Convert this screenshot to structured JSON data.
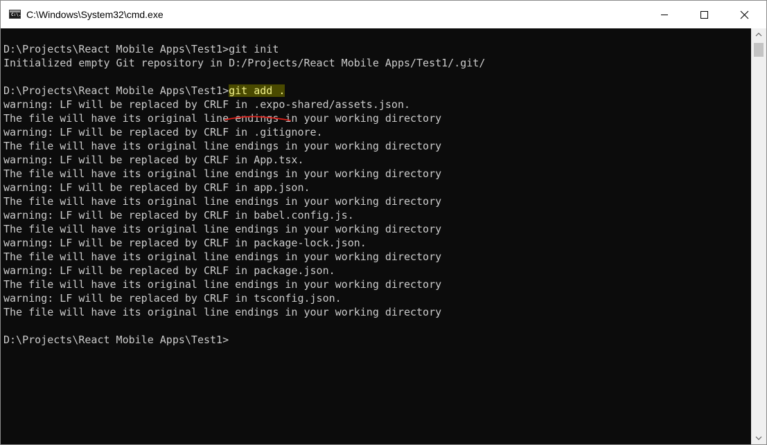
{
  "window": {
    "title": "C:\\Windows\\System32\\cmd.exe",
    "icon": "cmd-app-icon",
    "icon_glyph": "C:\\."
  },
  "colors": {
    "console_bg": "#0c0c0c",
    "console_text": "#cccccc",
    "highlight_bg": "#4a4a00",
    "highlight_text": "#f0f08a",
    "annotation": "#e0201a"
  },
  "console": {
    "prompt1": "D:\\Projects\\React Mobile Apps\\Test1>",
    "cmd1": "git init",
    "init_output": "Initialized empty Git repository in D:/Projects/React Mobile Apps/Test1/.git/",
    "prompt2": "D:\\Projects\\React Mobile Apps\\Test1>",
    "cmd2": "git add .",
    "output": [
      "warning: LF will be replaced by CRLF in .expo-shared/assets.json.",
      "The file will have its original line endings in your working directory",
      "warning: LF will be replaced by CRLF in .gitignore.",
      "The file will have its original line endings in your working directory",
      "warning: LF will be replaced by CRLF in App.tsx.",
      "The file will have its original line endings in your working directory",
      "warning: LF will be replaced by CRLF in app.json.",
      "The file will have its original line endings in your working directory",
      "warning: LF will be replaced by CRLF in babel.config.js.",
      "The file will have its original line endings in your working directory",
      "warning: LF will be replaced by CRLF in package-lock.json.",
      "The file will have its original line endings in your working directory",
      "warning: LF will be replaced by CRLF in package.json.",
      "The file will have its original line endings in your working directory",
      "warning: LF will be replaced by CRLF in tsconfig.json.",
      "The file will have its original line endings in your working directory"
    ],
    "prompt3": "D:\\Projects\\React Mobile Apps\\Test1>"
  }
}
